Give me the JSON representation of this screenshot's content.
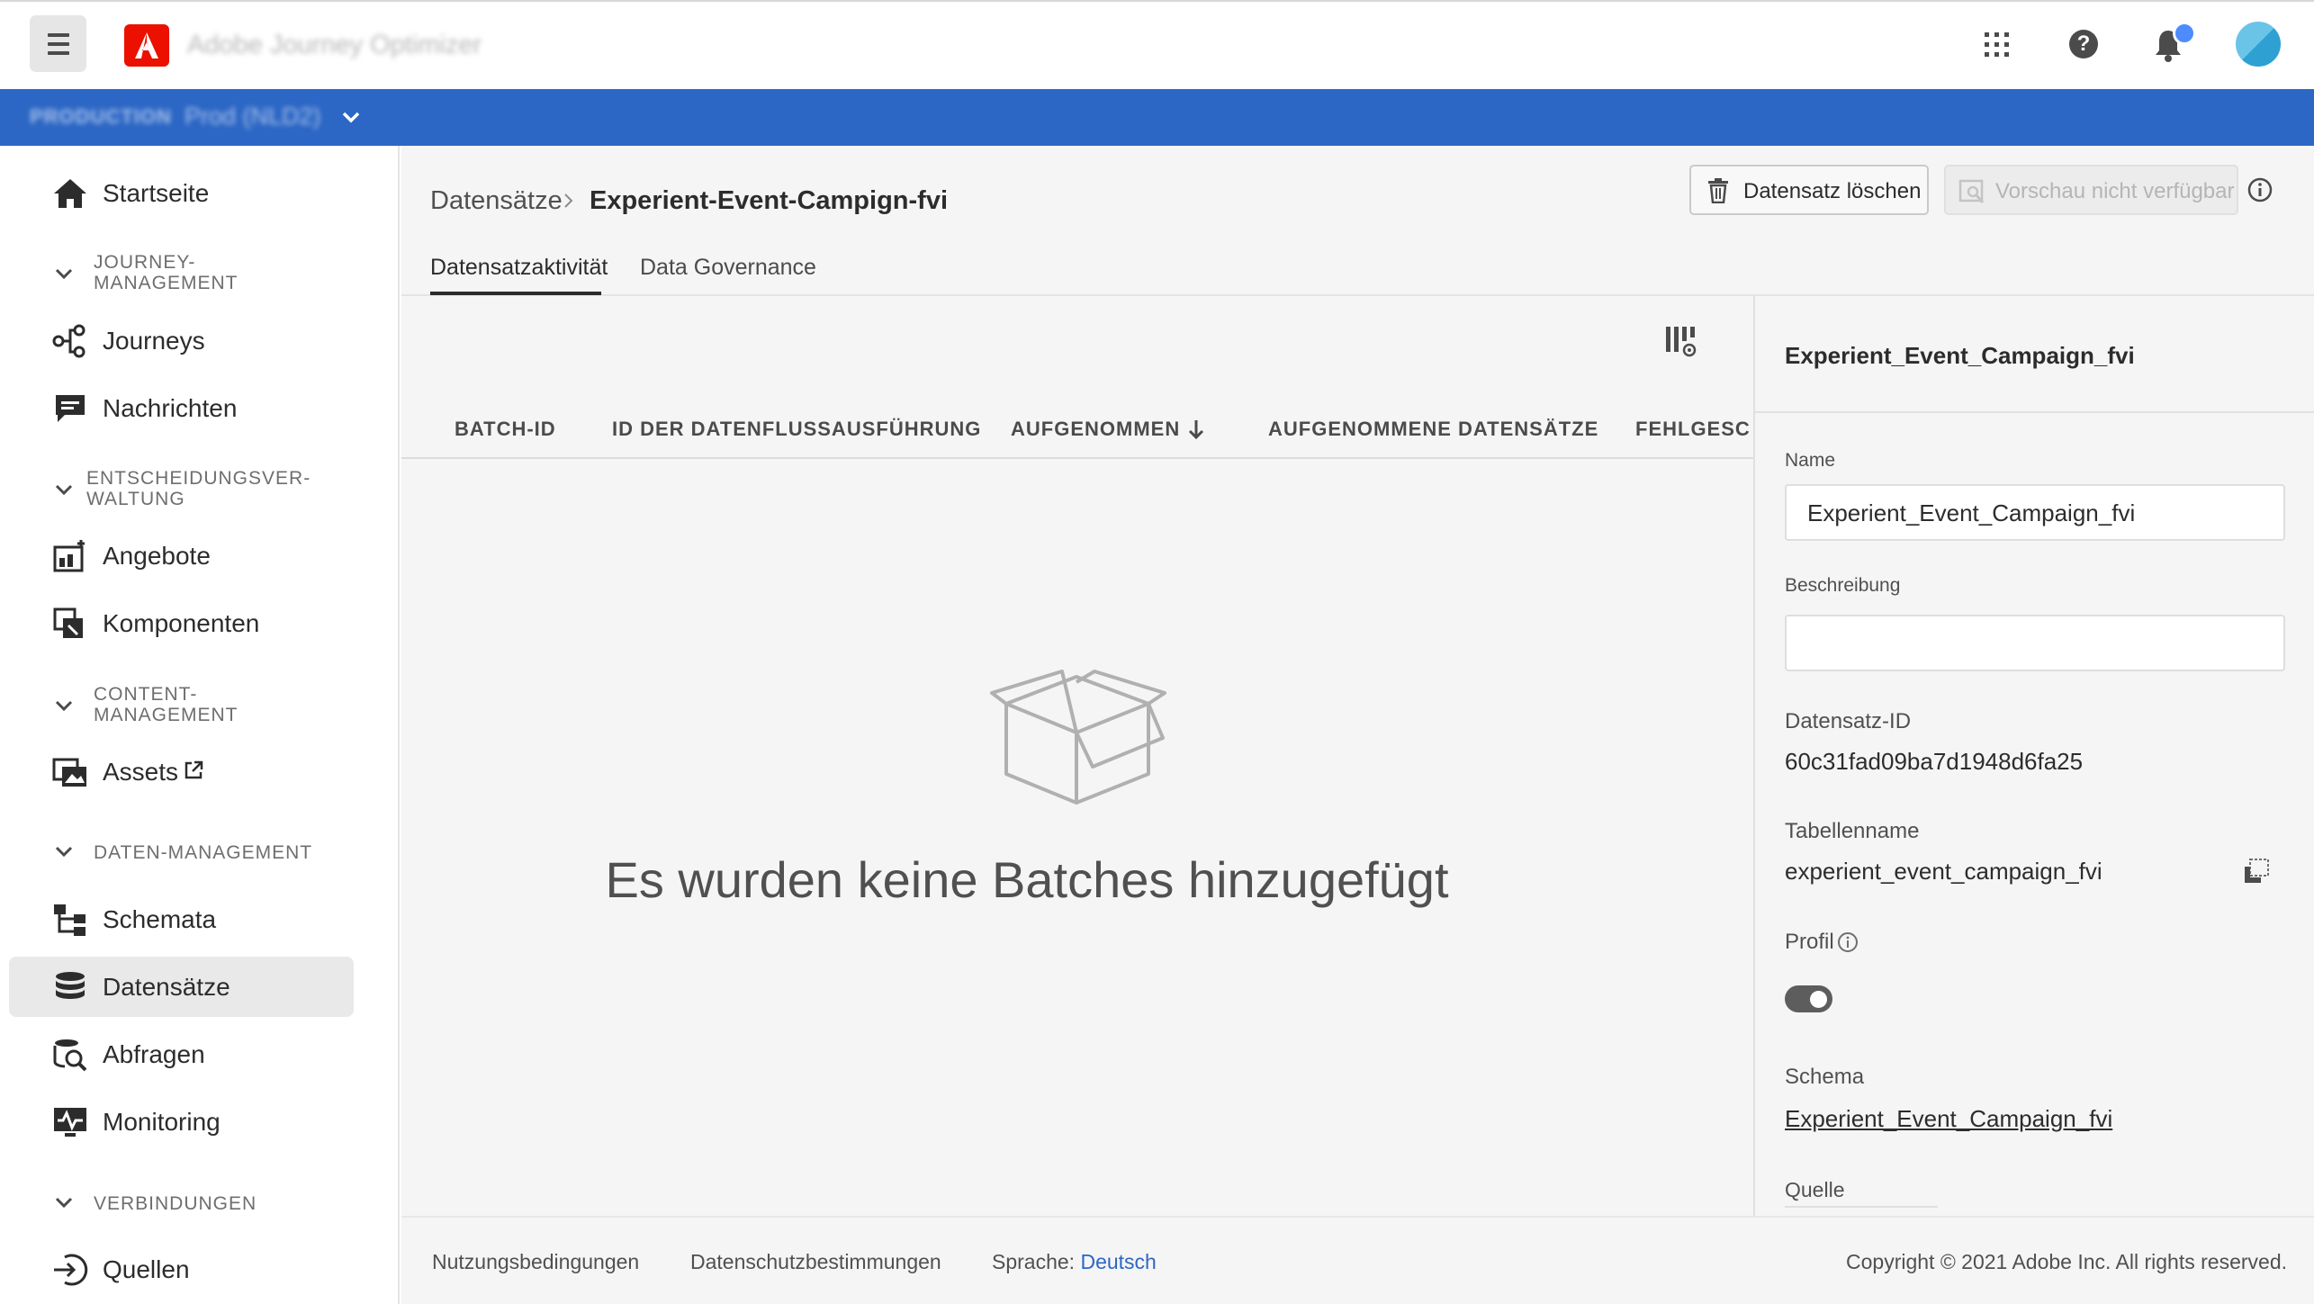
{
  "app": {
    "title": "Adobe Journey Optimizer",
    "environment_label": "PRODUCTION",
    "environment_name": "Prod (NLD2)"
  },
  "sidebar": {
    "items": [
      {
        "type": "item",
        "label": "Startseite",
        "icon": "home-icon"
      },
      {
        "type": "section",
        "label": "JOURNEY-\nMANAGEMENT"
      },
      {
        "type": "item",
        "label": "Journeys",
        "icon": "journeys-icon"
      },
      {
        "type": "item",
        "label": "Nachrichten",
        "icon": "message-icon"
      },
      {
        "type": "section",
        "label": "ENTSCHEIDUNGSVER-\nWALTUNG"
      },
      {
        "type": "item",
        "label": "Angebote",
        "icon": "offers-icon"
      },
      {
        "type": "item",
        "label": "Komponenten",
        "icon": "components-icon"
      },
      {
        "type": "section",
        "label": "CONTENT-\nMANAGEMENT"
      },
      {
        "type": "item",
        "label": "Assets",
        "icon": "assets-icon"
      },
      {
        "type": "section",
        "label": "DATEN-MANAGEMENT"
      },
      {
        "type": "item",
        "label": "Schemata",
        "icon": "schema-icon"
      },
      {
        "type": "item",
        "label": "Datensätze",
        "icon": "datasets-icon",
        "selected": true
      },
      {
        "type": "item",
        "label": "Abfragen",
        "icon": "queries-icon"
      },
      {
        "type": "item",
        "label": "Monitoring",
        "icon": "monitoring-icon"
      },
      {
        "type": "section",
        "label": "VERBINDUNGEN"
      },
      {
        "type": "item",
        "label": "Quellen",
        "icon": "sources-icon"
      }
    ]
  },
  "breadcrumb": {
    "root": "Datensätze",
    "current": "Experient-Event-Campign-fvi"
  },
  "actions": {
    "delete_label": "Datensatz löschen",
    "preview_label": "Vorschau nicht verfügbar"
  },
  "tabs": [
    "Datensatzaktivität",
    "Data Governance"
  ],
  "table": {
    "columns": [
      "BATCH-ID",
      "ID DER DATENFLUSSAUSFÜHRUNG",
      "AUFGENOMMEN",
      "AUFGENOMMENE DATENSÄTZE",
      "FEHLGESCH"
    ],
    "empty_message": "Es wurden keine Batches hinzugefügt"
  },
  "panel": {
    "title": "Experient_Event_Campaign_fvi",
    "name_label": "Name",
    "name_value": "Experient_Event_Campaign_fvi",
    "description_label": "Beschreibung",
    "description_value": "",
    "dataset_id_label": "Datensatz-ID",
    "dataset_id_value": "60c31fad09ba7d1948d6fa25",
    "table_name_label": "Tabellenname",
    "table_name_value": "experient_event_campaign_fvi",
    "profile_label": "Profil",
    "profile_enabled": true,
    "schema_label": "Schema",
    "schema_value": "Experient_Event_Campaign_fvi",
    "source_label": "Quelle"
  },
  "footer": {
    "terms": "Nutzungsbedingungen",
    "privacy": "Datenschutzbestimmungen",
    "language_label": "Sprache:",
    "language_value": "Deutsch",
    "copyright": "Copyright ©  2021 Adobe Inc.  All rights reserved."
  },
  "colors": {
    "brand_blue": "#2c67c5",
    "adobe_red": "#eb1000",
    "notification_dot": "#4d8bff"
  }
}
